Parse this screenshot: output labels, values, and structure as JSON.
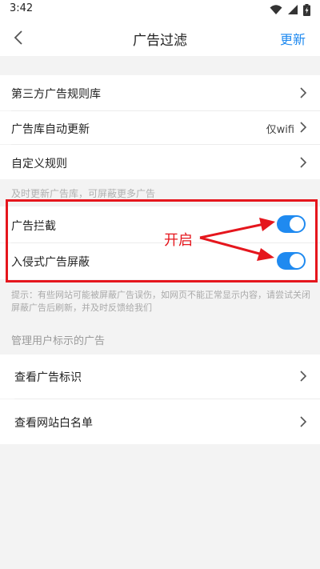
{
  "status": {
    "time": "3:42"
  },
  "header": {
    "title": "广告过滤",
    "action_label": "更新"
  },
  "rules": {
    "third_party": {
      "label": "第三方广告规则库"
    },
    "auto_update": {
      "label": "广告库自动更新",
      "value": "仅wifi"
    },
    "custom": {
      "label": "自定义规则"
    }
  },
  "hint_text": "及时更新广告库，可屏蔽更多广告",
  "blocking": {
    "ad_block": {
      "label": "广告拦截",
      "enabled": true
    },
    "intrusive": {
      "label": "入侵式广告屏蔽",
      "enabled": true
    }
  },
  "annotation": {
    "text": "开启"
  },
  "tip_text": "提示：有些网站可能被屏蔽广告误伤，如网页不能正常显示内容，请尝试关闭屏蔽广告后刷新，并及时反馈给我们",
  "user_marked": {
    "section_title": "管理用户标示的广告",
    "view_marks": {
      "label": "查看广告标识"
    },
    "whitelist": {
      "label": "查看网站白名单"
    }
  },
  "colors": {
    "accent": "#1f8af0",
    "annotation": "#e5161d",
    "background": "#f3f3f3"
  }
}
